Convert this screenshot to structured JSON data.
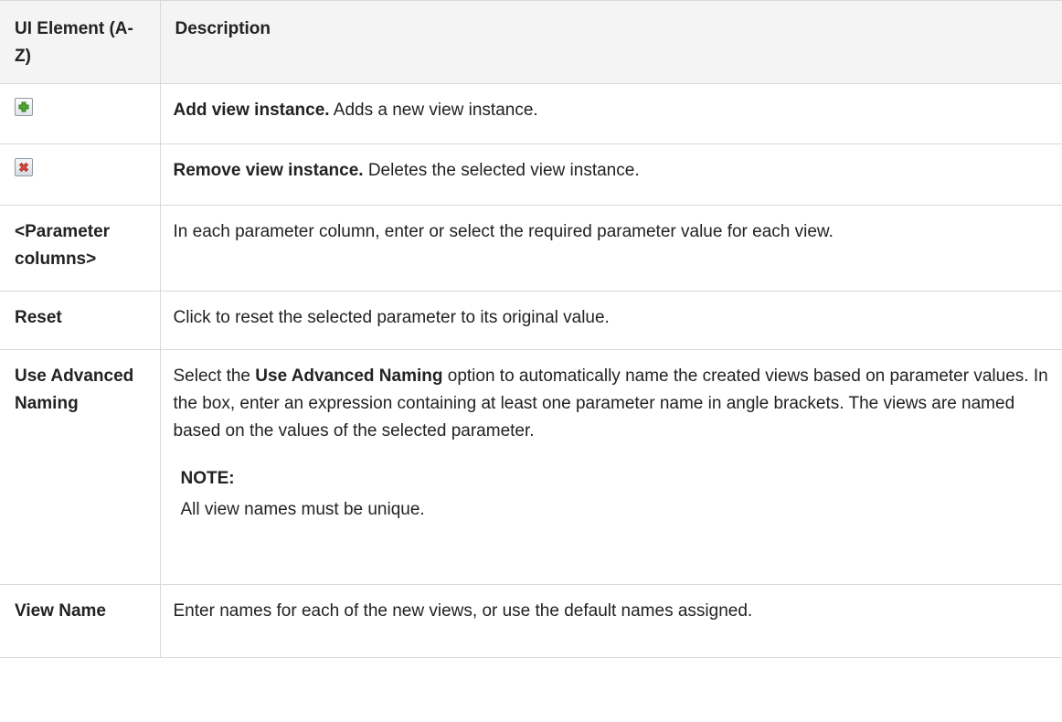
{
  "table": {
    "headers": {
      "element": "UI Element (A-Z)",
      "description": "Description"
    },
    "rows": [
      {
        "icon": "add-view-instance-icon",
        "desc_bold": "Add view instance.",
        "desc_text": " Adds a new view instance."
      },
      {
        "icon": "remove-view-instance-icon",
        "desc_bold": "Remove view instance.",
        "desc_text": " Deletes the selected view instance."
      },
      {
        "element": "<Parameter columns>",
        "desc_text": "In each parameter column, enter or select the required parameter value for each view."
      },
      {
        "element": "Reset",
        "desc_text": "Click to reset the selected parameter to its original value."
      },
      {
        "element": "Use Advanced Naming",
        "desc_pre": "Select the ",
        "desc_bold": "Use Advanced Naming",
        "desc_post": " option to automatically name the created views based on parameter values. In the box, enter an expression containing at least one parameter name in angle brackets. The views are named based on the values of the selected parameter.",
        "note_title": "NOTE:",
        "note_text": "All view names must be unique."
      },
      {
        "element": "View Name",
        "desc_text": "Enter names for each of the new views, or use the default names assigned."
      }
    ]
  },
  "colors": {
    "border": "#d9d9d9",
    "header_bg": "#f4f4f4",
    "add_icon": "#3f9b25",
    "remove_icon": "#d9342b"
  }
}
